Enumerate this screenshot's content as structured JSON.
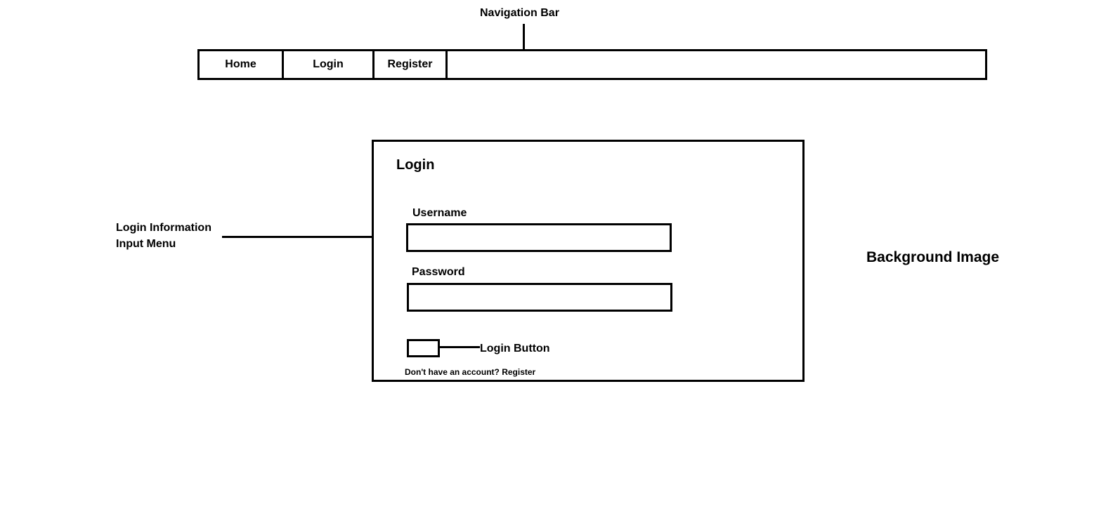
{
  "annotations": {
    "navigation_bar": "Navigation Bar",
    "login_info_line1": "Login Information",
    "login_info_line2": "Input Menu",
    "login_button": "Login Button",
    "background_image": "Background Image"
  },
  "nav": {
    "items": [
      {
        "label": "Home"
      },
      {
        "label": "Login"
      },
      {
        "label": "Register"
      }
    ]
  },
  "login_panel": {
    "title": "Login",
    "username_label": "Username",
    "username_value": "",
    "password_label": "Password",
    "password_value": "",
    "register_prompt": "Don't have an account? Register"
  }
}
